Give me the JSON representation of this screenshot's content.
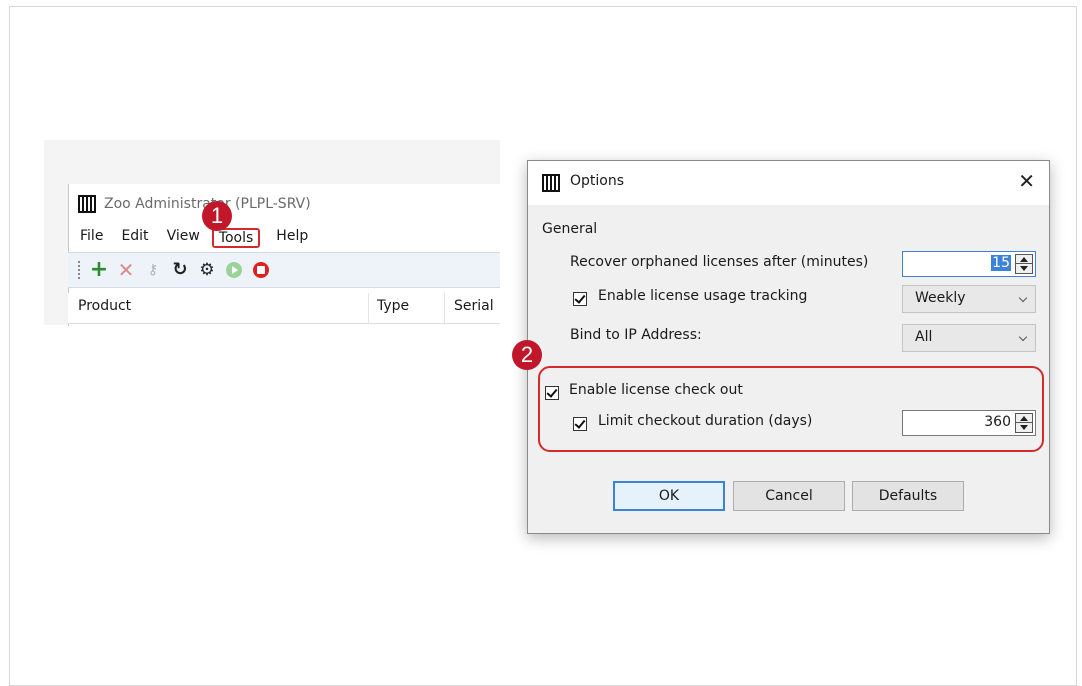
{
  "main_window": {
    "title": "Zoo Administrator (PLPL-SRV)",
    "menu": [
      "File",
      "Edit",
      "View",
      "Tools",
      "Help"
    ],
    "toolbar_icons": [
      "add-icon",
      "delete-icon",
      "key-icon",
      "refresh-icon",
      "gear-icon",
      "start-icon",
      "stop-icon"
    ],
    "columns": [
      "Product",
      "Type",
      "Serial"
    ]
  },
  "badges": {
    "one": "1",
    "two": "2"
  },
  "options": {
    "title": "Options",
    "close": "✕",
    "section": "General",
    "recover_label": "Recover orphaned licenses after (minutes)",
    "recover_value": "15",
    "tracking_label": "Enable license usage tracking",
    "tracking_value": "Weekly",
    "bind_label": "Bind to IP Address:",
    "bind_value": "All",
    "checkout_label": "Enable license check out",
    "limit_label": "Limit checkout duration (days)",
    "limit_value": "360",
    "buttons": {
      "ok": "OK",
      "cancel": "Cancel",
      "defaults": "Defaults"
    }
  },
  "colors": {
    "highlight": "#d32b2b",
    "badge": "#c0182a",
    "accent": "#3c82d8"
  }
}
